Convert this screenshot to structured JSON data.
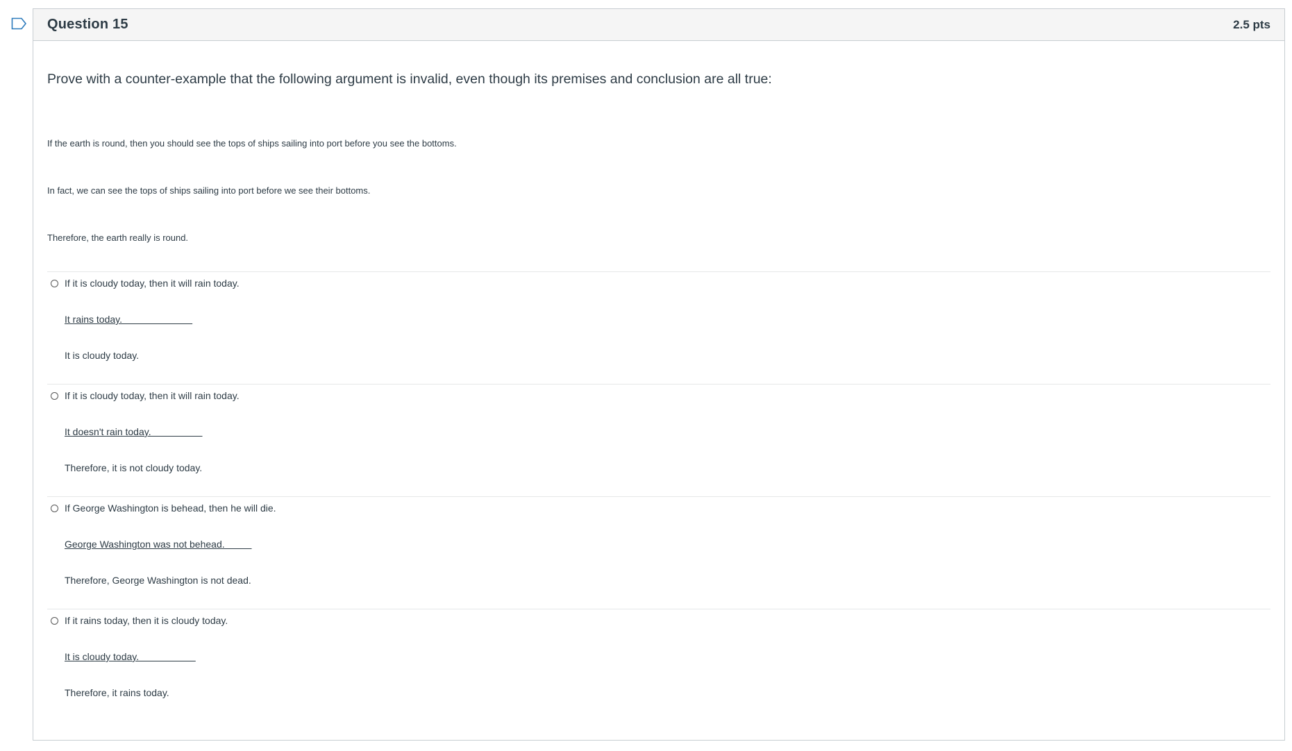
{
  "question": {
    "title": "Question 15",
    "points": "2.5 pts",
    "prompt": "Prove with a counter-example that the following argument is invalid, even though its premises and conclusion are all true:",
    "premises": [
      "If the earth is round, then you should see the tops of ships sailing into port before you see the bottoms.",
      "In fact, we can see the tops of ships sailing into port before we see their bottoms.",
      "Therefore, the earth really is round."
    ]
  },
  "answers": [
    {
      "line1": "If it is cloudy today, then it will rain today.",
      "line2": "It rains today.                          ",
      "line3": "It is cloudy today."
    },
    {
      "line1": "If it is cloudy today, then it will rain today.",
      "line2": "It doesn't rain today.                   ",
      "line3": "Therefore, it is not cloudy today."
    },
    {
      "line1": "If George Washington is behead, then he will die.",
      "line2": "George Washington was not behead.          ",
      "line3": "Therefore, George Washington is not dead."
    },
    {
      "line1": "If it rains today, then it is cloudy today.",
      "line2": "It is cloudy today.                     ",
      "line3": "Therefore, it rains today."
    }
  ],
  "icons": {
    "flag": "bookmark-flag-icon",
    "radio": "radio-button-icon"
  },
  "colors": {
    "text": "#2d3b45",
    "border": "#c7cdd1",
    "header_bg": "#f5f5f5",
    "flag_stroke": "#2b7abc"
  }
}
